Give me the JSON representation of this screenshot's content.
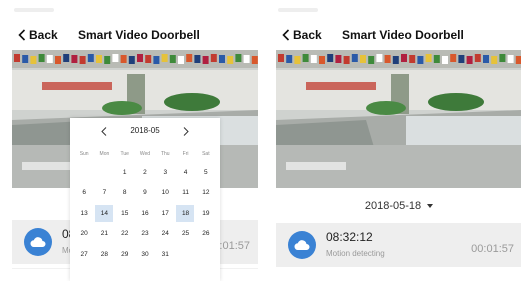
{
  "left": {
    "header": {
      "back_label": "Back",
      "title": "Smart  Video Doorbell"
    },
    "calendar": {
      "month": "2018-05",
      "weekdays": [
        "Sun",
        "Mon",
        "Tue",
        "Wed",
        "Thu",
        "Fri",
        "Sat"
      ],
      "days": [
        "",
        "",
        "1",
        "2",
        "3",
        "4",
        "5",
        "6",
        "7",
        "8",
        "9",
        "10",
        "11",
        "12",
        "13",
        "14",
        "15",
        "16",
        "17",
        "18",
        "19",
        "20",
        "21",
        "22",
        "23",
        "24",
        "25",
        "26",
        "27",
        "28",
        "29",
        "30",
        "31",
        "",
        ""
      ],
      "highlighted_days": [
        "14",
        "18"
      ]
    },
    "recording": {
      "time": "08:3",
      "desc": "Mo",
      "duration": "00:01:57"
    }
  },
  "right": {
    "header": {
      "back_label": "Back",
      "title": "Smart  Video Doorbell"
    },
    "date_label": "2018-05-18",
    "recording": {
      "time": "08:32:12",
      "desc": "Motion detecting",
      "duration": "00:01:57"
    }
  },
  "colors": {
    "accent": "#3a82d4",
    "highlight": "#d6e4f3",
    "list_bg": "#eeeeee"
  },
  "icons": {
    "back": "chevron-left-icon",
    "cloud": "cloud-icon",
    "dropdown": "caret-down-icon"
  }
}
